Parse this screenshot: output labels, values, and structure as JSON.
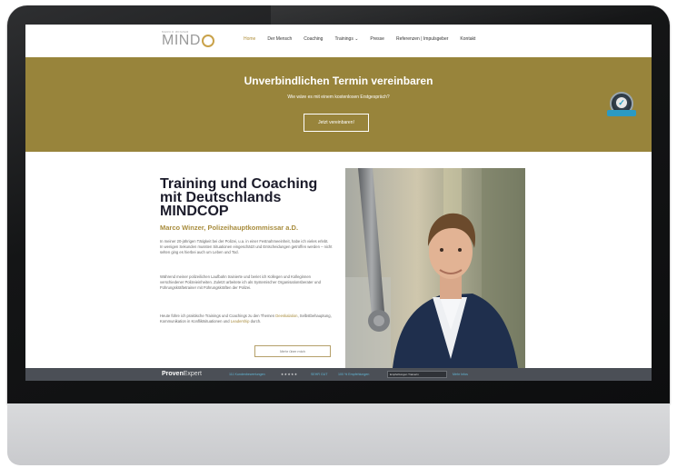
{
  "logo": {
    "tagline": "MARCO WINZER",
    "name": "MIND",
    "mark": "CO"
  },
  "nav": {
    "items": [
      "Home",
      "Der Mensch",
      "Coaching",
      "Trainings ⌄",
      "Presse",
      "Referenzen | Impulsgeber",
      "Kontakt"
    ],
    "active_index": 0,
    "accent": "#b08f3a"
  },
  "banner": {
    "title": "Unverbindlichen Termin vereinbaren",
    "subtitle": "Wie wäre es mit einem kostenlosen Erstgespräch?",
    "button": "Jetzt vereinbaren!",
    "background": "#98843b"
  },
  "seal": {
    "icon": "check-icon"
  },
  "hero": {
    "headline_line1": "Training und Coaching",
    "headline_line2": "mit Deutschlands",
    "headline_line3": "MINDCOP",
    "subline": "Marco Winzer, Polizeihauptkommissar a.D.",
    "para1": "In meiner 20-jährigen Tätigkeit bei der Polizei, u.a. in einer Festnahmeeinheit, habe ich vieles erlebt. In wenigen Sekunden mussten Situationen eingeschätzt und Entscheidungen getroffen werden – nicht selten ging es hierbei auch um Leben und Tod.",
    "para2": "Während meiner polizeilichen Laufbahn trainierte und beriet ich Kollegen und Kolleginnen verschiedener Polizeieinheiten. Zuletzt arbeitete ich als Systemischer Organisationsberater und Führungskräftetrainer mit Führungskräften der Polizei.",
    "para3_start": "Heute führe ich praktische Trainings und Coachings zu den Themen ",
    "para3_gold1": "Deeskalation",
    "para3_mid": ", Selbstbehauptung, Kommunikation in Konfliktsituationen und ",
    "para3_gold2": "Leadership",
    "para3_end": " durch.",
    "more_button": "Mehr über mich"
  },
  "proven_expert": {
    "brand_bold": "Proven",
    "brand_thin": "Expert",
    "reviews": "111 Kundenbewertungen",
    "stars": "★★★★★",
    "score": "SEHR GUT",
    "recommendations": "100 % Empfehlungen",
    "field_value": "Empfehlungen Trainerin",
    "more": "Mehr Infos"
  }
}
